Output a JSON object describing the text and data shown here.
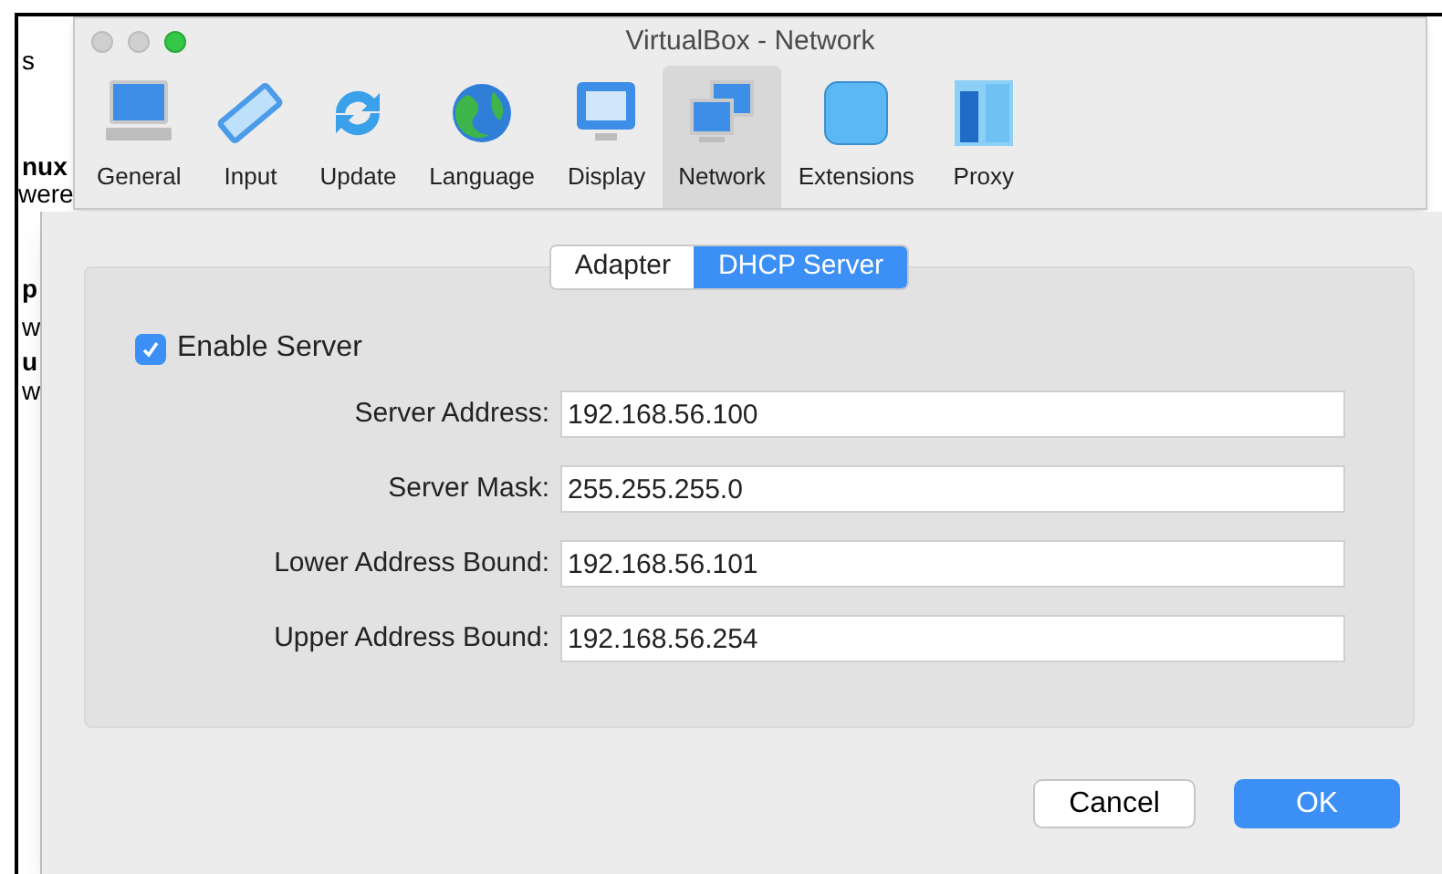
{
  "background_window": {
    "fragments": [
      {
        "text": "s",
        "bold": false
      },
      {
        "text": "nux",
        "bold": true
      },
      {
        "text": "were",
        "bold": false
      },
      {
        "text": "p",
        "bold": true
      },
      {
        "text": "w",
        "bold": false
      },
      {
        "text": "u",
        "bold": true
      },
      {
        "text": "w",
        "bold": false
      }
    ]
  },
  "window": {
    "title": "VirtualBox - Network"
  },
  "toolbar": [
    {
      "label": "General",
      "selected": false
    },
    {
      "label": "Input",
      "selected": false
    },
    {
      "label": "Update",
      "selected": false
    },
    {
      "label": "Language",
      "selected": false
    },
    {
      "label": "Display",
      "selected": false
    },
    {
      "label": "Network",
      "selected": true
    },
    {
      "label": "Extensions",
      "selected": false
    },
    {
      "label": "Proxy",
      "selected": false
    }
  ],
  "tabs": [
    {
      "label": "Adapter",
      "selected": false
    },
    {
      "label": "DHCP Server",
      "selected": true
    }
  ],
  "enable_server": {
    "label": "Enable Server",
    "checked": true
  },
  "fields": [
    {
      "label": "Server Address:",
      "value": "192.168.56.100"
    },
    {
      "label": "Server Mask:",
      "value": "255.255.255.0"
    },
    {
      "label": "Lower Address Bound:",
      "value": "192.168.56.101"
    },
    {
      "label": "Upper Address Bound:",
      "value": "192.168.56.254"
    }
  ],
  "buttons": [
    {
      "label": "Cancel",
      "kind": "secondary"
    },
    {
      "label": "OK",
      "kind": "primary"
    }
  ]
}
